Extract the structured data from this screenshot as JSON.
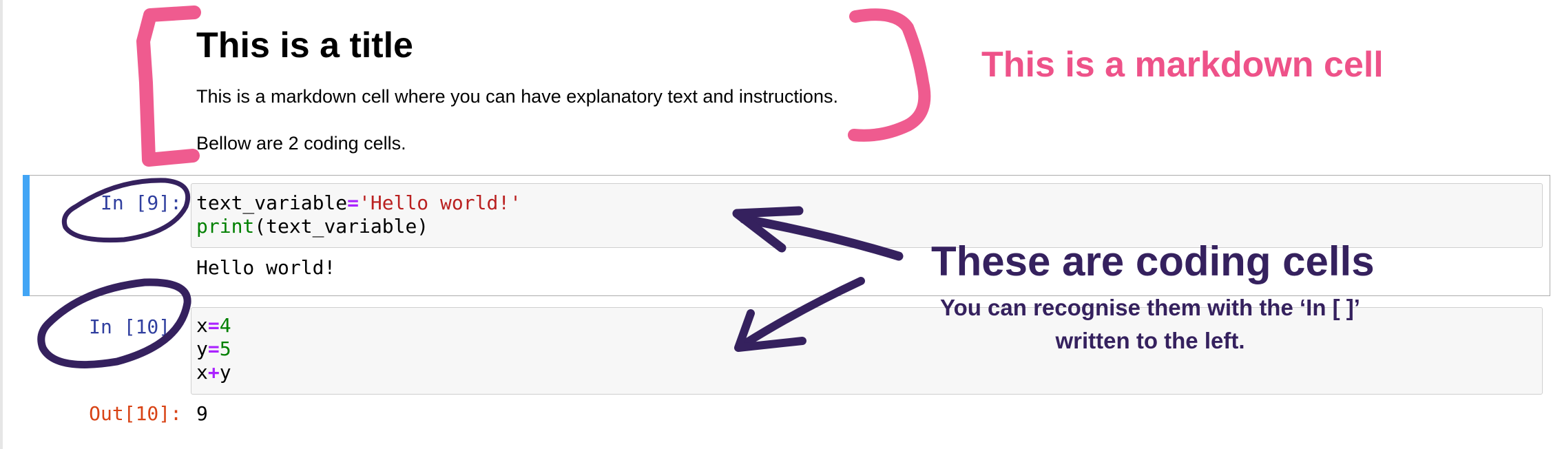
{
  "markdown_cell": {
    "title": "This is a title",
    "paragraph_1": "This is a markdown cell where you can have explanatory text and instructions.",
    "paragraph_2": "Bellow are 2 coding cells."
  },
  "code_cells": [
    {
      "prompt": "In [9]:",
      "lines": {
        "line_1_name": "text_variable",
        "line_1_op": "=",
        "line_1_str": "'Hello world!'",
        "line_2_builtin": "print",
        "line_2_rest": "(text_variable)"
      },
      "output": "Hello world!"
    },
    {
      "prompt": "In [10]:",
      "lines": {
        "line_1_name": "x",
        "line_1_op": "=",
        "line_1_num": "4",
        "line_2_name": "y",
        "line_2_op": "=",
        "line_2_num": "5",
        "line_3_a": "x",
        "line_3_op": "+",
        "line_3_b": "y"
      },
      "out_prompt": "Out[10]:",
      "out_value": "9"
    }
  ],
  "annotations": {
    "markdown_label": "This is a markdown cell",
    "coding_title": "These are coding cells",
    "coding_subtitle": "You can recognise them with the ‘In [ ]’ written to the left."
  },
  "colors": {
    "markdown_annotation": "#ee5289",
    "coding_annotation": "#35215e",
    "active_cell_bar": "#42a5f5",
    "prompt_in": "#303f9f",
    "prompt_out": "#d84315"
  }
}
